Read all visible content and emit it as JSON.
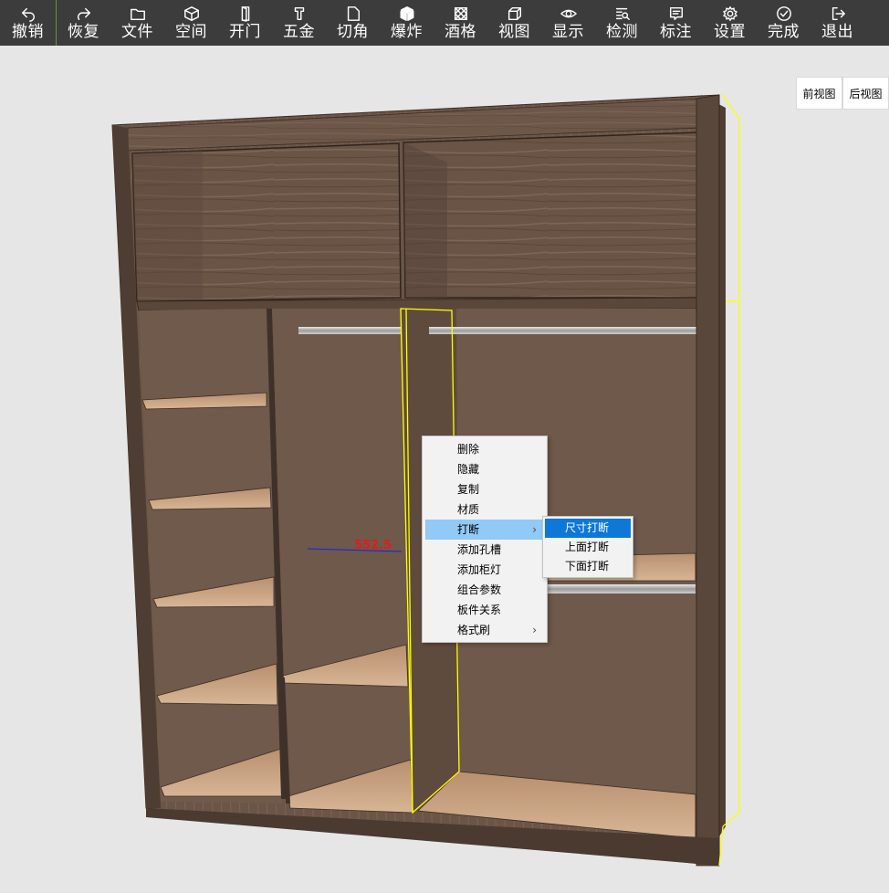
{
  "toolbar": {
    "items": [
      {
        "label": "撤销",
        "icon": "undo-icon"
      },
      {
        "label": "恢复",
        "icon": "redo-icon"
      },
      {
        "label": "文件",
        "icon": "folder-icon"
      },
      {
        "label": "空间",
        "icon": "cube-icon"
      },
      {
        "label": "开门",
        "icon": "door-icon"
      },
      {
        "label": "五金",
        "icon": "hardware-icon"
      },
      {
        "label": "切角",
        "icon": "cut-corner-icon"
      },
      {
        "label": "爆炸",
        "icon": "explode-icon"
      },
      {
        "label": "酒格",
        "icon": "wine-grid-icon"
      },
      {
        "label": "视图",
        "icon": "view-icon"
      },
      {
        "label": "显示",
        "icon": "eye-icon"
      },
      {
        "label": "检测",
        "icon": "inspect-icon"
      },
      {
        "label": "标注",
        "icon": "annotate-icon"
      },
      {
        "label": "设置",
        "icon": "gear-icon"
      },
      {
        "label": "完成",
        "icon": "check-circle-icon"
      },
      {
        "label": "退出",
        "icon": "exit-icon"
      }
    ]
  },
  "view_buttons": {
    "front": "前视图",
    "back": "后视图"
  },
  "dimension": "552.5",
  "context_menu": {
    "items": [
      {
        "label": "删除"
      },
      {
        "label": "隐藏"
      },
      {
        "label": "复制"
      },
      {
        "label": "材质"
      },
      {
        "label": "打断",
        "submenu": true,
        "highlighted": true
      },
      {
        "label": "添加孔槽"
      },
      {
        "label": "添加柜灯"
      },
      {
        "label": "组合参数"
      },
      {
        "label": "板件关系"
      },
      {
        "label": "格式刷",
        "submenu": true
      }
    ],
    "submenu_arrow": "›",
    "submenu": [
      {
        "label": "尺寸打断",
        "active": true
      },
      {
        "label": "上面打断"
      },
      {
        "label": "下面打断"
      }
    ]
  },
  "colors": {
    "toolbar_bg": "#3c3c3c",
    "canvas_bg": "#e6e6e6",
    "wood_dark": "#6b5647",
    "wood_light": "#c9a382",
    "selection": "#ffff00",
    "menu_highlight": "#91c9f7",
    "submenu_active": "#0d78d8"
  }
}
